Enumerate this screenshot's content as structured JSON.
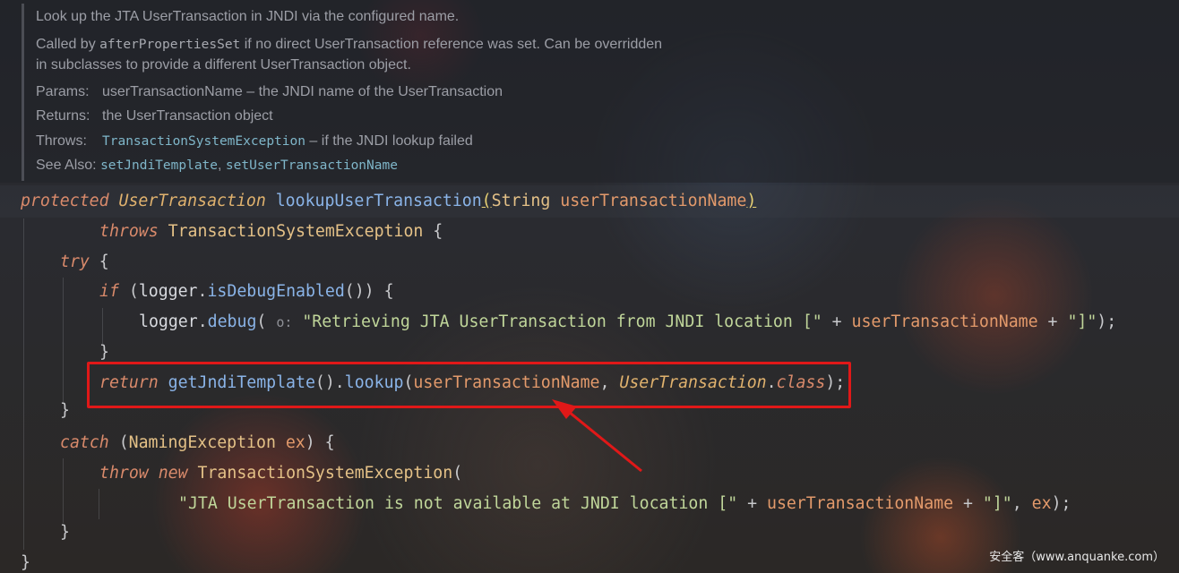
{
  "doc": {
    "summary": "Look up the JTA UserTransaction in JNDI via the configured name.",
    "called_by_prefix": "Called by ",
    "called_by_method": "afterPropertiesSet",
    "called_by_suffix": " if no direct UserTransaction reference was set. Can be overridden",
    "called_by_line2": "in subclasses to provide a different UserTransaction object.",
    "params_label": "Params:",
    "params_text": "userTransactionName – the JNDI name of the UserTransaction",
    "returns_label": "Returns:",
    "returns_text": "the UserTransaction object",
    "throws_label": "Throws:",
    "throws_link": "TransactionSystemException",
    "throws_text": " – if the JNDI lookup failed",
    "see_also_label": "See Also:",
    "see_also_1": "setJndiTemplate",
    "see_also_sep": ", ",
    "see_also_2": "setUserTransactionName"
  },
  "code": {
    "l1_protected": "protected",
    "l1_type": "UserTransaction",
    "l1_method": "lookupUserTransaction",
    "l1_open": "(",
    "l1_ptype": "String",
    "l1_pname": "userTransactionName",
    "l1_close": ")",
    "l2_throws": "throws",
    "l2_exc": "TransactionSystemException",
    "l2_brace": " {",
    "l3_try": "try",
    "l3_brace": " {",
    "l4_if": "if",
    "l4_open": " (",
    "l4_logger": "logger",
    "l4_dot": ".",
    "l4_method": "isDebugEnabled",
    "l4_rest": "()) {",
    "l5_logger": "logger",
    "l5_dot": ".",
    "l5_method": "debug",
    "l5_open": "( ",
    "l5_hint": "o:",
    "l5_str": " \"Retrieving JTA UserTransaction from JNDI location [\"",
    "l5_plus": " + ",
    "l5_var": "userTransactionName",
    "l5_plus2": " + ",
    "l5_str2": "\"]\"",
    "l5_end": ");",
    "l6_brace": "}",
    "l7_return": "return",
    "l7_method": "getJndiTemplate",
    "l7_call": "().",
    "l7_lookup": "lookup",
    "l7_open": "(",
    "l7_arg": "userTransactionName",
    "l7_comma": ", ",
    "l7_cls": "UserTransaction",
    "l7_dot": ".",
    "l7_class": "class",
    "l7_end": ");",
    "l8_brace": "}",
    "l9_catch": "catch",
    "l9_open": " (",
    "l9_exc": "NamingException",
    "l9_var": " ex",
    "l9_rest": ") {",
    "l10_throw": "throw",
    "l10_new": "new",
    "l10_exc": "TransactionSystemException",
    "l10_open": "(",
    "l11_str": "\"JTA UserTransaction is not available at JNDI location [\"",
    "l11_plus": " + ",
    "l11_var": "userTransactionName",
    "l11_plus2": " + ",
    "l11_str2": "\"]\"",
    "l11_comma": ", ",
    "l11_ex": "ex",
    "l11_end": ");",
    "l12_brace": "}",
    "l13_brace": "}"
  },
  "watermark": "安全客（www.anquanke.com）",
  "colors": {
    "highlight_box": "#e01818",
    "arrow": "#e01818"
  }
}
